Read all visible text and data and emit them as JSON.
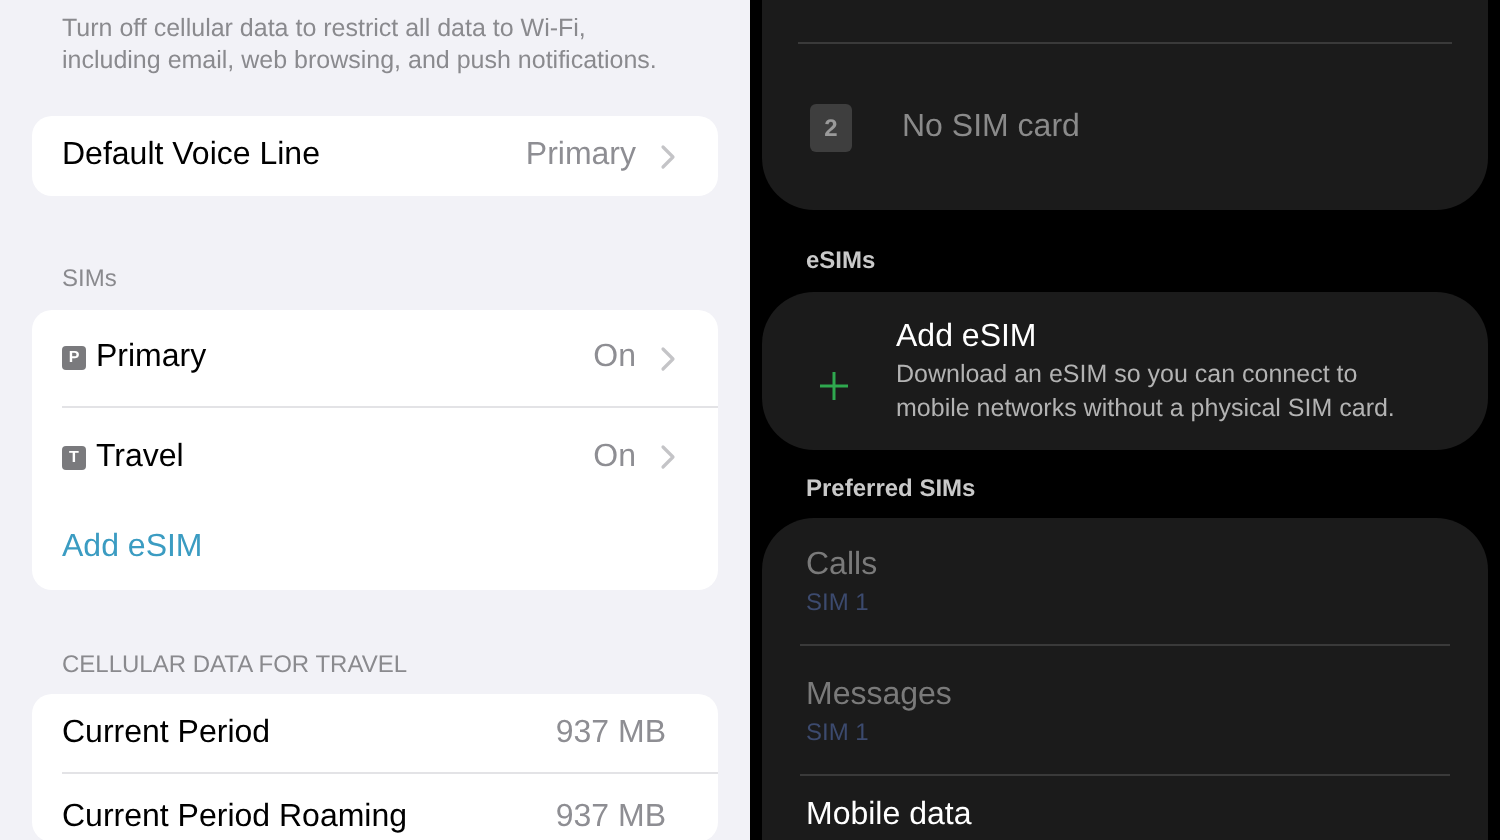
{
  "ios": {
    "note": "Turn off cellular data to restrict all data to Wi-Fi, including email, web browsing, and push notifications.",
    "voice_line": {
      "label": "Default Voice Line",
      "value": "Primary"
    },
    "sims": {
      "header": "SIMs",
      "rows": [
        {
          "kind": "sim",
          "badge": "P",
          "label": "Primary",
          "value": "On"
        },
        {
          "kind": "sim",
          "badge": "T",
          "label": "Travel",
          "value": "On"
        },
        {
          "kind": "link",
          "label": "Add eSIM"
        }
      ]
    },
    "cellular_data": {
      "header": "CELLULAR DATA FOR TRAVEL",
      "rows": [
        {
          "label": "Current Period",
          "value": "937 MB"
        },
        {
          "label": "Current Period Roaming",
          "value": "937 MB"
        }
      ]
    }
  },
  "android": {
    "sim_slot": {
      "badge": "2",
      "label": "No SIM card"
    },
    "esims": {
      "header": "eSIMs",
      "title": "Add eSIM",
      "description": "Download an eSIM so you can connect to mobile networks without a physical SIM card."
    },
    "preferred": {
      "header": "Preferred SIMs",
      "rows": [
        {
          "label": "Calls",
          "value": "SIM 1",
          "disabled": true
        },
        {
          "label": "Messages",
          "value": "SIM 1",
          "disabled": true
        },
        {
          "label": "Mobile data",
          "disabled": false
        }
      ]
    }
  }
}
